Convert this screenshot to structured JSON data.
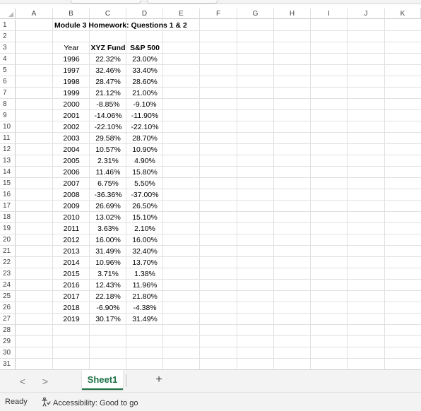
{
  "columns": [
    "A",
    "B",
    "C",
    "D",
    "E",
    "F",
    "G",
    "H",
    "I",
    "J",
    "K"
  ],
  "rows": [
    "1",
    "2",
    "3",
    "4",
    "5",
    "6",
    "7",
    "8",
    "9",
    "10",
    "11",
    "12",
    "13",
    "14",
    "15",
    "16",
    "17",
    "18",
    "19",
    "20",
    "21",
    "22",
    "23",
    "24",
    "25",
    "26",
    "27",
    "28",
    "29",
    "30",
    "31"
  ],
  "title": "Module 3 Homework: Questions 1 & 2",
  "headers": {
    "year": "Year",
    "fund": "XYZ Fund",
    "sp": "S&P 500"
  },
  "table": [
    [
      "1996",
      "22.32%",
      "23.00%"
    ],
    [
      "1997",
      "32.46%",
      "33.40%"
    ],
    [
      "1998",
      "28.47%",
      "28.60%"
    ],
    [
      "1999",
      "21.12%",
      "21.00%"
    ],
    [
      "2000",
      "-8.85%",
      "-9.10%"
    ],
    [
      "2001",
      "-14.06%",
      "-11.90%"
    ],
    [
      "2002",
      "-22.10%",
      "-22.10%"
    ],
    [
      "2003",
      "29.58%",
      "28.70%"
    ],
    [
      "2004",
      "10.57%",
      "10.90%"
    ],
    [
      "2005",
      "2.31%",
      "4.90%"
    ],
    [
      "2006",
      "11.46%",
      "15.80%"
    ],
    [
      "2007",
      "6.75%",
      "5.50%"
    ],
    [
      "2008",
      "-36.36%",
      "-37.00%"
    ],
    [
      "2009",
      "26.69%",
      "26.50%"
    ],
    [
      "2010",
      "13.02%",
      "15.10%"
    ],
    [
      "2011",
      "3.63%",
      "2.10%"
    ],
    [
      "2012",
      "16.00%",
      "16.00%"
    ],
    [
      "2013",
      "31.49%",
      "32.40%"
    ],
    [
      "2014",
      "10.96%",
      "13.70%"
    ],
    [
      "2015",
      "3.71%",
      "1.38%"
    ],
    [
      "2016",
      "12.43%",
      "11.96%"
    ],
    [
      "2017",
      "22.18%",
      "21.80%"
    ],
    [
      "2018",
      "-6.90%",
      "-4.38%"
    ],
    [
      "2019",
      "30.17%",
      "31.49%"
    ]
  ],
  "sheet_nav": {
    "prev": "<",
    "next": ">"
  },
  "sheet_tab": "Sheet1",
  "add_sheet": "+",
  "status": {
    "ready": "Ready",
    "accessibility": "Accessibility: Good to go"
  },
  "colors": {
    "accent": "#1e7145",
    "gridline": "#e1e1e1"
  },
  "icons": {
    "accessibility": "accessibility-icon",
    "corner": "select-all-triangle-icon"
  }
}
